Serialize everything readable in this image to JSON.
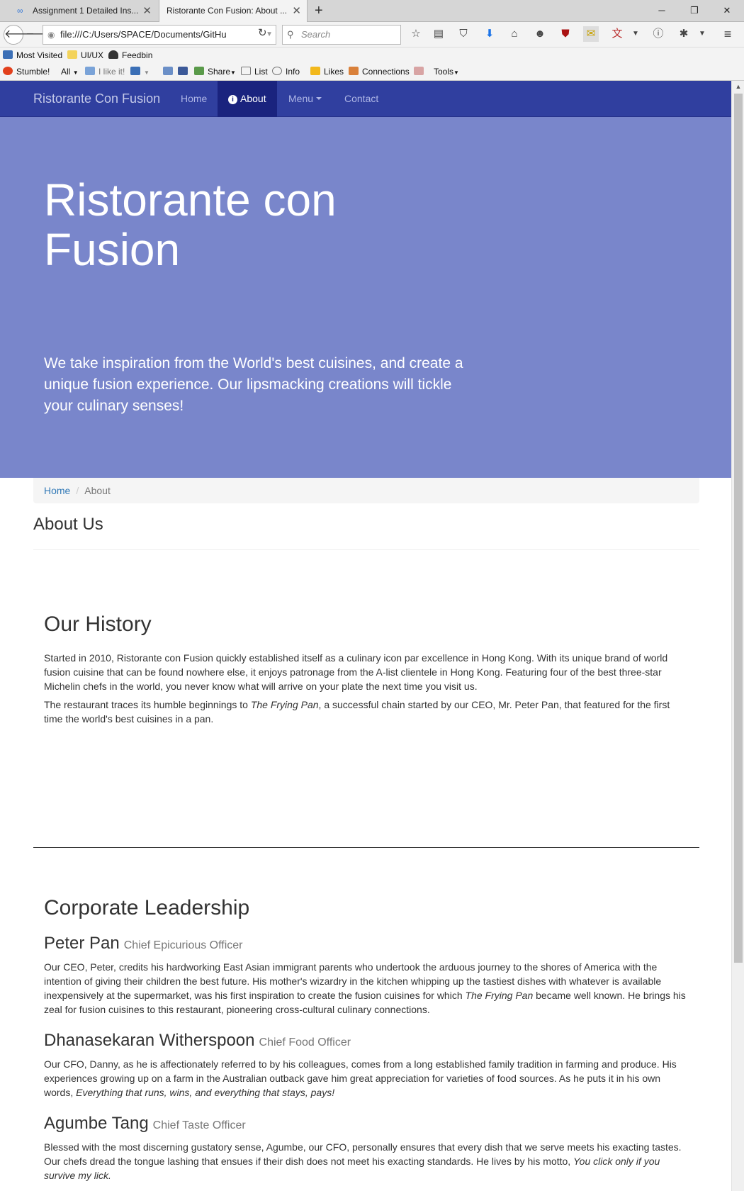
{
  "browser": {
    "tabs": [
      {
        "label": "Assignment 1 Detailed Ins...",
        "active": false
      },
      {
        "label": "Ristorante Con Fusion: About ...",
        "active": true
      }
    ],
    "url": "file:///C:/Users/SPACE/Documents/GitHu",
    "search_placeholder": "Search",
    "bookmarks_row1": [
      "Most Visited",
      "UI/UX",
      "Feedbin"
    ],
    "bookmarks_row2": [
      "Stumble!",
      "All",
      "I like it!",
      "Share",
      "List",
      "Info",
      "Likes",
      "Connections",
      "Tools"
    ]
  },
  "site": {
    "brand": "Ristorante Con Fusion",
    "nav": [
      {
        "label": "Home",
        "active": false
      },
      {
        "label": "About",
        "active": true
      },
      {
        "label": "Menu",
        "active": false
      },
      {
        "label": "Contact",
        "active": false
      }
    ],
    "hero": {
      "title": "Ristorante con Fusion",
      "text": "We take inspiration from the World's best cuisines, and create a unique fusion experience. Our lipsmacking creations will tickle your culinary senses!"
    },
    "breadcrumb": {
      "home": "Home",
      "current": "About"
    },
    "about_title": "About Us",
    "history": {
      "title": "Our History",
      "p1": "Started in 2010, Ristorante con Fusion quickly established itself as a culinary icon par excellence in Hong Kong. With its unique brand of world fusion cuisine that can be found nowhere else, it enjoys patronage from the A-list clientele in Hong Kong. Featuring four of the best three-star Michelin chefs in the world, you never know what will arrive on your plate the next time you visit us.",
      "p2_before": "The restaurant traces its humble beginnings to ",
      "p2_em": "The Frying Pan",
      "p2_after": ", a successful chain started by our CEO, Mr. Peter Pan, that featured for the first time the world's best cuisines in a pan."
    },
    "leadership": {
      "title": "Corporate Leadership",
      "leaders": [
        {
          "name": "Peter Pan",
          "role": "Chief Epicurious Officer",
          "bio_before": "Our CEO, Peter, credits his hardworking East Asian immigrant parents who undertook the arduous journey to the shores of America with the intention of giving their children the best future. His mother's wizardry in the kitchen whipping up the tastiest dishes with whatever is available inexpensively at the supermarket, was his first inspiration to create the fusion cuisines for which ",
          "bio_em": "The Frying Pan",
          "bio_after": " became well known. He brings his zeal for fusion cuisines to this restaurant, pioneering cross-cultural culinary connections."
        },
        {
          "name": "Dhanasekaran Witherspoon",
          "role": "Chief Food Officer",
          "bio_before": "Our CFO, Danny, as he is affectionately referred to by his colleagues, comes from a long established family tradition in farming and produce. His experiences growing up on a farm in the Australian outback gave him great appreciation for varieties of food sources. As he puts it in his own words, ",
          "bio_em": "Everything that runs, wins, and everything that stays, pays!",
          "bio_after": ""
        },
        {
          "name": "Agumbe Tang",
          "role": "Chief Taste Officer",
          "bio_before": "Blessed with the most discerning gustatory sense, Agumbe, our CFO, personally ensures that every dish that we serve meets his exacting tastes. Our chefs dread the tongue lashing that ensues if their dish does not meet his exacting standards. He lives by his motto, ",
          "bio_em": "You click only if you survive my lick.",
          "bio_after": ""
        }
      ]
    }
  },
  "colors": {
    "navbar": "#303f9f",
    "nav_active": "#1a237e",
    "jumbotron": "#7986cb",
    "link": "#337ab7"
  }
}
